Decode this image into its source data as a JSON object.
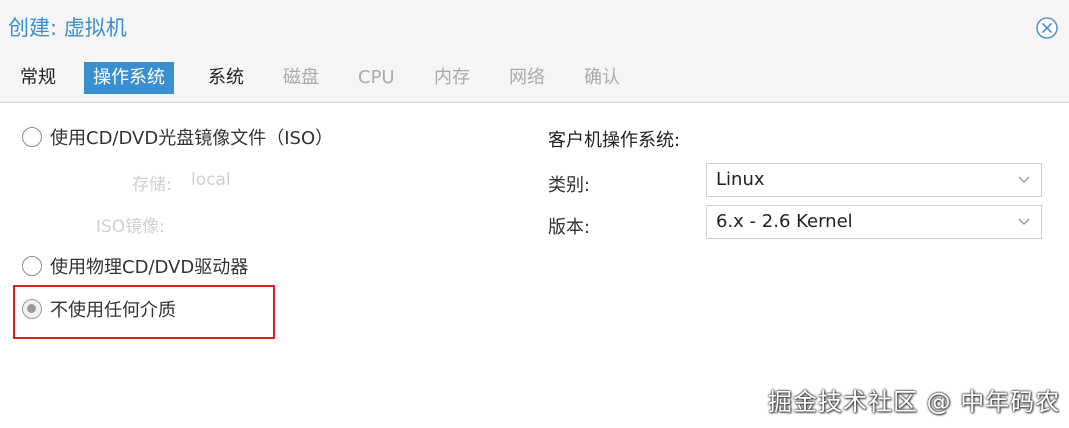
{
  "dialog": {
    "title": "创建: 虚拟机"
  },
  "tabs": [
    {
      "label": "常规",
      "state": "normal"
    },
    {
      "label": "操作系统",
      "state": "active"
    },
    {
      "label": "系统",
      "state": "normal"
    },
    {
      "label": "磁盘",
      "state": "disabled"
    },
    {
      "label": "CPU",
      "state": "disabled"
    },
    {
      "label": "内存",
      "state": "disabled"
    },
    {
      "label": "网络",
      "state": "disabled"
    },
    {
      "label": "确认",
      "state": "disabled"
    }
  ],
  "media": {
    "option_iso": "使用CD/DVD光盘镜像文件（ISO）",
    "storage_label": "存储:",
    "storage_value": "local",
    "iso_label": "ISO镜像:",
    "option_physical": "使用物理CD/DVD驱动器",
    "option_none": "不使用任何介质",
    "selected": "option_none"
  },
  "guest_os": {
    "heading": "客户机操作系统:",
    "type_label": "类别:",
    "type_value": "Linux",
    "version_label": "版本:",
    "version_value": "6.x - 2.6 Kernel"
  },
  "watermark": "掘金技术社区 @ 中年码农",
  "colors": {
    "accent": "#3a8fd1",
    "highlight": "#e02020",
    "disabled_text": "#aaaaaa"
  }
}
